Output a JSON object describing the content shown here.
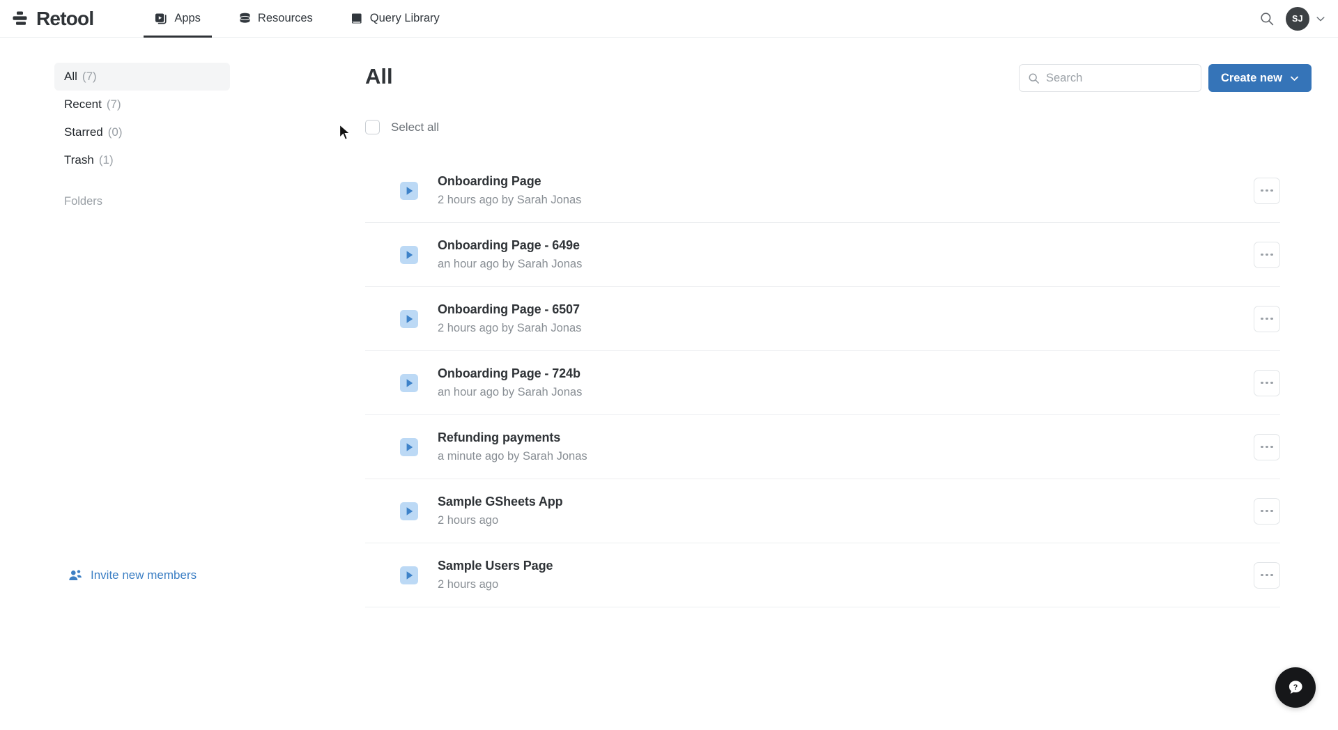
{
  "brand": {
    "name": "Retool",
    "logo_icon": "retool-stacked-bars-logo",
    "logo_color": "#2f3337"
  },
  "topnav": {
    "tabs": [
      {
        "label": "Apps",
        "icon": "apps-play-square-icon",
        "active": true
      },
      {
        "label": "Resources",
        "icon": "database-stack-icon",
        "active": false
      },
      {
        "label": "Query Library",
        "icon": "book-icon",
        "active": false
      }
    ],
    "search_icon": "search-icon",
    "avatar": {
      "initials": "SJ",
      "icon": "avatar",
      "caret_icon": "chevron-down-icon"
    }
  },
  "sidebar": {
    "items": [
      {
        "label": "All",
        "count": "(7)",
        "selected": true
      },
      {
        "label": "Recent",
        "count": "(7)",
        "selected": false
      },
      {
        "label": "Starred",
        "count": "(0)",
        "selected": false
      },
      {
        "label": "Trash",
        "count": "(1)",
        "selected": false
      }
    ],
    "folders_label": "Folders",
    "invite": {
      "label": "Invite new members",
      "icon": "add-people-icon",
      "color": "#3c7fc4"
    }
  },
  "main": {
    "title": "All",
    "search": {
      "placeholder": "Search",
      "value": "",
      "icon": "search-icon"
    },
    "create_button": {
      "label": "Create new",
      "caret_icon": "chevron-down-icon",
      "color": "#3574b8"
    },
    "select_all": {
      "label": "Select all",
      "checked": false
    },
    "row_menu_icon": "ellipsis-horizontal-icon",
    "app_icon": "play-triangle-icon",
    "apps": [
      {
        "name": "Onboarding Page",
        "meta": "2 hours ago by Sarah Jonas"
      },
      {
        "name": "Onboarding Page - 649e",
        "meta": "an hour ago by Sarah Jonas"
      },
      {
        "name": "Onboarding Page - 6507",
        "meta": "2 hours ago by Sarah Jonas"
      },
      {
        "name": "Onboarding Page - 724b",
        "meta": "an hour ago by Sarah Jonas"
      },
      {
        "name": "Refunding payments",
        "meta": "a minute ago by Sarah Jonas"
      },
      {
        "name": "Sample GSheets App",
        "meta": "2 hours ago"
      },
      {
        "name": "Sample Users Page",
        "meta": "2 hours ago"
      }
    ]
  },
  "help_fab": {
    "icon": "help-chat-question-icon",
    "color": "#161719"
  }
}
